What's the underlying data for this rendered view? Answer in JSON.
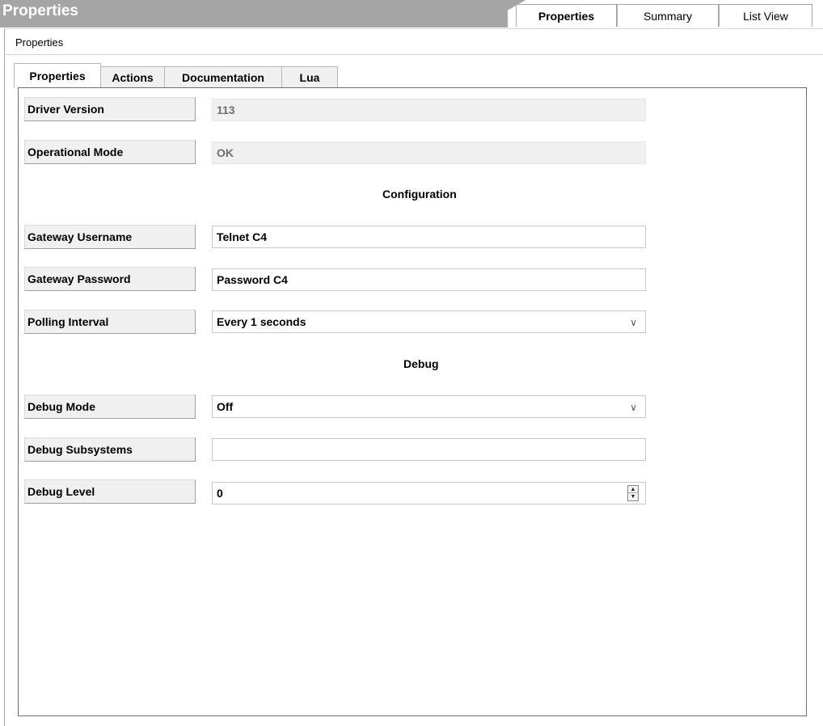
{
  "window": {
    "title": "Properties"
  },
  "top_tabs": [
    {
      "label": "Properties",
      "active": true
    },
    {
      "label": "Summary",
      "active": false
    },
    {
      "label": "List View",
      "active": false
    }
  ],
  "section": {
    "label": "Properties"
  },
  "sub_tabs": [
    {
      "label": "Properties",
      "active": true
    },
    {
      "label": "Actions",
      "active": false
    },
    {
      "label": "Documentation",
      "active": false
    },
    {
      "label": "Lua",
      "active": false
    }
  ],
  "properties": {
    "driver_version": {
      "label": "Driver Version",
      "value": "113"
    },
    "operational_mode": {
      "label": "Operational Mode",
      "value": "OK"
    },
    "configuration_heading": "Configuration",
    "gateway_username": {
      "label": "Gateway Username",
      "value": "Telnet C4"
    },
    "gateway_password": {
      "label": "Gateway Password",
      "value": "Password C4"
    },
    "polling_interval": {
      "label": "Polling Interval",
      "value": "Every 1 seconds"
    },
    "debug_heading": "Debug",
    "debug_mode": {
      "label": "Debug Mode",
      "value": "Off"
    },
    "debug_subsystems": {
      "label": "Debug Subsystems",
      "value": ""
    },
    "debug_level": {
      "label": "Debug Level",
      "value": "0"
    }
  },
  "icons": {
    "dropdown": "chevron-down-icon",
    "spinner_up": "spinner-up-icon",
    "spinner_down": "spinner-down-icon"
  },
  "colors": {
    "title_bar": "#a5a5a5",
    "label_bg": "#f0f0f0",
    "readonly_bg": "#f0f0f0"
  }
}
